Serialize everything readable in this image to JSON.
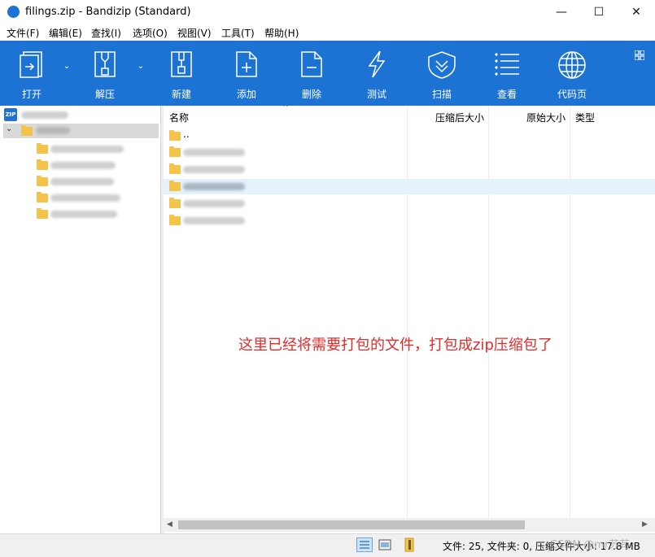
{
  "window": {
    "title": "filings.zip - Bandizip (Standard)",
    "controls": {
      "minimize": "—",
      "maximize": "☐",
      "close": "✕"
    }
  },
  "menu": [
    "文件(F)",
    "编辑(E)",
    "查找(I)",
    "选项(O)",
    "视图(V)",
    "工具(T)",
    "帮助(H)"
  ],
  "toolbar": {
    "open": "打开",
    "extract": "解压",
    "new": "新建",
    "add": "添加",
    "delete": "删除",
    "test": "测试",
    "scan": "扫描",
    "view": "查看",
    "codepage": "代码页",
    "dropdown_glyph": "⌄",
    "accent": "#1d73d3"
  },
  "tree": {
    "zip_badge": "ZIP",
    "expander": "⌄"
  },
  "filelist": {
    "columns": {
      "name": "名称",
      "compressed": "压缩后大小",
      "original": "原始大小",
      "type": "类型"
    },
    "sort_indicator": "^",
    "rows": [
      {
        "name": ".."
      }
    ]
  },
  "annotation": "这里已经将需要打包的文件，打包成zip压缩包了",
  "scrollbar": {
    "left": "◀",
    "right": "▶"
  },
  "status": {
    "text": "文件: 25, 文件夹: 0, 压缩文件大小: 17.8 MB",
    "watermark": "CSDN @mr苏苟"
  }
}
